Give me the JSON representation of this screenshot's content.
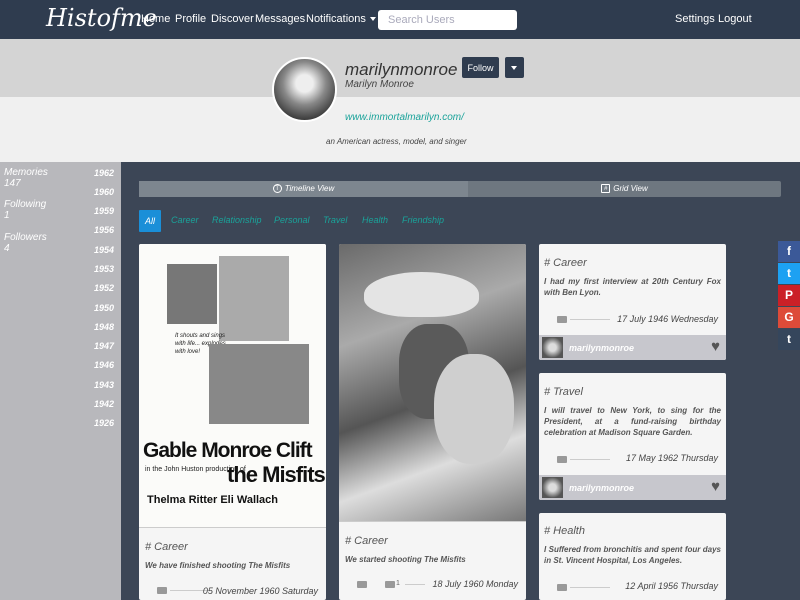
{
  "nav": {
    "logo": "Histofme",
    "home": "Home",
    "profile": "Profile",
    "discover": "Discover",
    "messages": "Messages",
    "notifications": "Notifications",
    "search_placeholder": "Search Users",
    "settings": "Settings",
    "logout": "Logout"
  },
  "profile": {
    "username": "marilynmonroe",
    "fullname": "Marilyn Monroe",
    "follow": "Follow",
    "website": "www.immortalmarilyn.com/",
    "bio": "an American actress, model, and singer"
  },
  "stats": [
    {
      "label": "Memories",
      "value": "147"
    },
    {
      "label": "Following",
      "value": "1"
    },
    {
      "label": "Followers",
      "value": "4"
    }
  ],
  "years": [
    "1962",
    "1960",
    "1959",
    "1956",
    "1954",
    "1953",
    "1952",
    "1950",
    "1948",
    "1947",
    "1946",
    "1943",
    "1942",
    "1926"
  ],
  "views": {
    "timeline": "Timeline View",
    "grid": "Grid View"
  },
  "categories": [
    "All",
    "Career",
    "Relationship",
    "Personal",
    "Travel",
    "Health",
    "Friendship"
  ],
  "cards": [
    {
      "title": "# Career",
      "text": "We have finished shooting The Misfits",
      "date": "05 November 1960 Saturday",
      "poster": [
        "It shouts and sings with life... explodes with love!",
        "Gable Monroe Clift",
        "in the John Huston production of",
        "the Misfits",
        "Thelma Ritter  Eli Wallach"
      ]
    },
    {
      "title": "# Career",
      "text": "We started shooting The Misfits",
      "date": "18 July 1960 Monday",
      "count": "1"
    },
    {
      "title": "# Career",
      "text": "I had my first interview at 20th Century Fox with Ben Lyon.",
      "date": "17 July 1946 Wednesday",
      "user": "marilynmonroe"
    },
    {
      "title": "# Travel",
      "text": "I will travel to New York, to sing for the President, at a fund-raising birthday celebration at Madison Square Garden.",
      "date": "17 May 1962 Thursday",
      "user": "marilynmonroe"
    },
    {
      "title": "# Health",
      "text": "I Suffered from bronchitis and spent four days in St. Vincent Hospital, Los Angeles.",
      "date": "12 April 1956 Thursday"
    }
  ],
  "social": [
    {
      "glyph": "f",
      "color": "#3b5998"
    },
    {
      "glyph": "t",
      "color": "#1da1f2"
    },
    {
      "glyph": "P",
      "color": "#cb2027"
    },
    {
      "glyph": "G",
      "color": "#dd4b39"
    },
    {
      "glyph": "t",
      "color": "#35465c"
    }
  ]
}
